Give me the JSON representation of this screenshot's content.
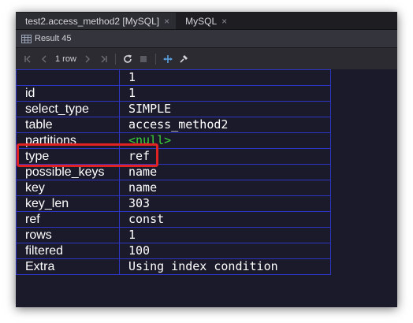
{
  "tabs": [
    {
      "label": "test2.access_method2 [MySQL]",
      "close": "×",
      "active": true
    },
    {
      "label": "MySQL",
      "close": "×",
      "active": false
    }
  ],
  "result_tab": {
    "label": "Result 45"
  },
  "toolbar": {
    "row_count": "1 row"
  },
  "grid": {
    "header": {
      "key": "",
      "value": "1"
    },
    "rows": [
      {
        "key": "id",
        "value": "1"
      },
      {
        "key": "select_type",
        "value": "SIMPLE"
      },
      {
        "key": "table",
        "value": "access_method2"
      },
      {
        "key": "partitions",
        "value": "<null>"
      },
      {
        "key": "type",
        "value": "ref"
      },
      {
        "key": "possible_keys",
        "value": "name"
      },
      {
        "key": "key",
        "value": "name"
      },
      {
        "key": "key_len",
        "value": "303"
      },
      {
        "key": "ref",
        "value": "const"
      },
      {
        "key": "rows",
        "value": "1"
      },
      {
        "key": "filtered",
        "value": "100"
      },
      {
        "key": "Extra",
        "value": "Using index condition"
      }
    ]
  },
  "colors": {
    "grid_border": "#2e35c4",
    "null_value": "#3bd33b",
    "highlight": "#e02222",
    "background": "#1a1a2a"
  }
}
